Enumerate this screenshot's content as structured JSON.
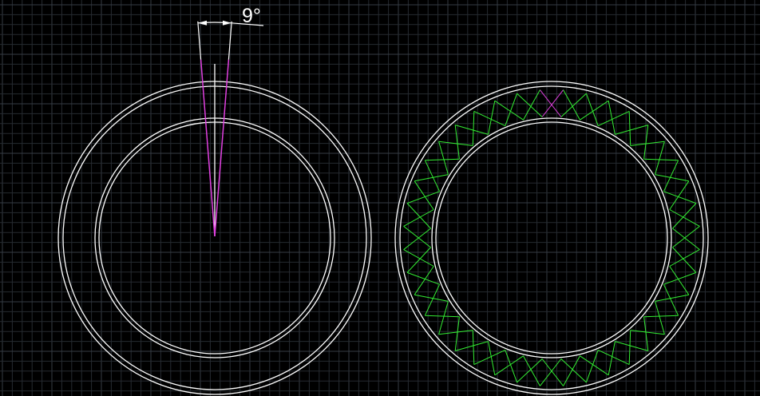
{
  "colors": {
    "background": "#000000",
    "grid_minor": "#262b31",
    "grid_major": "#363c44",
    "outline": "#ffffff",
    "wedge": "#e040e0",
    "pattern": "#33ee33"
  },
  "dimension": {
    "angle_label": "9°",
    "angle_degrees": 9
  },
  "array": {
    "segment_count": 40,
    "angle_step_degrees": 9
  }
}
